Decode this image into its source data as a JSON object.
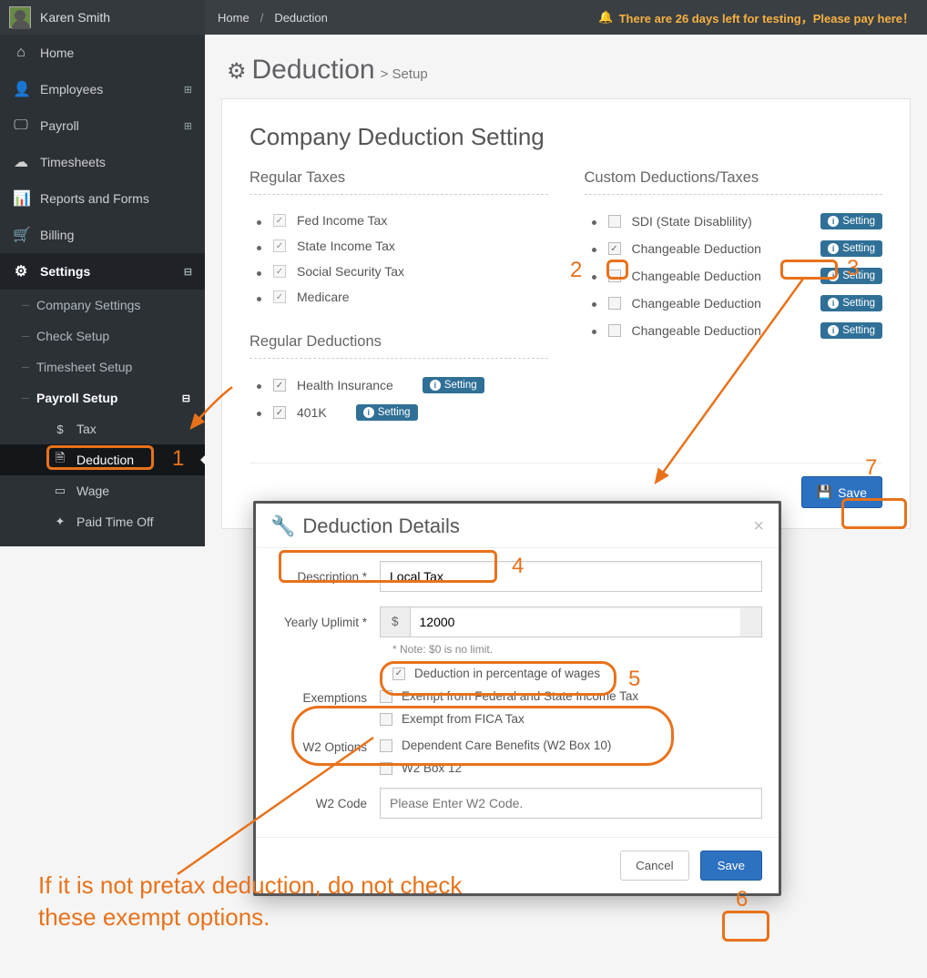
{
  "user": {
    "name": "Karen Smith"
  },
  "breadcrumb": {
    "home": "Home",
    "current": "Deduction"
  },
  "alert": {
    "bell": "🔔",
    "text": "There are 26 days left for testing，Please pay here！"
  },
  "sidebar": {
    "home": "Home",
    "employees": "Employees",
    "payroll": "Payroll",
    "timesheets": "Timesheets",
    "reports": "Reports and Forms",
    "billing": "Billing",
    "settings": "Settings",
    "company_settings": "Company Settings",
    "check_setup": "Check Setup",
    "timesheet_setup": "Timesheet Setup",
    "payroll_setup": "Payroll Setup",
    "tax": "Tax",
    "deduction": "Deduction",
    "wage": "Wage",
    "pto": "Paid Time Off"
  },
  "page": {
    "title": "Deduction",
    "subtitle": "> Setup"
  },
  "panel": {
    "heading_a": "Company Deduction ",
    "heading_b": "Setting",
    "sec_regular_taxes": "Regular Taxes",
    "sec_regular_deductions": "Regular Deductions",
    "sec_custom": "Custom Deductions/Taxes",
    "regular_taxes": [
      {
        "label": "Fed Income Tax"
      },
      {
        "label": "State Income Tax"
      },
      {
        "label": "Social Security Tax"
      },
      {
        "label": "Medicare"
      }
    ],
    "regular_deductions": [
      {
        "label": "Health Insurance"
      },
      {
        "label": "401K"
      }
    ],
    "custom": [
      {
        "label": "SDI (State Disablility)",
        "checked": false
      },
      {
        "label": "Changeable Deduction",
        "checked": true
      },
      {
        "label": "Changeable Deduction",
        "checked": false
      },
      {
        "label": "Changeable Deduction",
        "checked": false
      },
      {
        "label": "Changeable Deduction",
        "checked": false
      }
    ],
    "setting_btn": "Setting",
    "save_btn": "Save"
  },
  "modal": {
    "title": "Deduction Details",
    "lbl_description": "Description *",
    "val_description": "Local Tax",
    "lbl_uplimit": "Yearly Uplimit *",
    "currency": "$",
    "val_uplimit": "12000",
    "note": "* Note: $0 is no limit.",
    "chk_percentage": "Deduction in percentage of wages",
    "lbl_exemptions": "Exemptions",
    "chk_exempt_fed": "Exempt from Federal and State Income Tax",
    "chk_exempt_fica": "Exempt from FICA Tax",
    "lbl_w2opts": "W2 Options",
    "chk_w2_dependent": "Dependent Care Benefits (W2 Box 10)",
    "chk_w2_box12": "W2 Box 12",
    "lbl_w2code": "W2 Code",
    "ph_w2code": "Please Enter W2 Code.",
    "btn_cancel": "Cancel",
    "btn_save": "Save"
  },
  "annotations": {
    "n1": "1",
    "n2": "2",
    "n3": "3",
    "n4": "4",
    "n5": "5",
    "n6": "6",
    "n7": "7",
    "note_text": "If it is not pretax deduction, do not check these exempt options."
  }
}
